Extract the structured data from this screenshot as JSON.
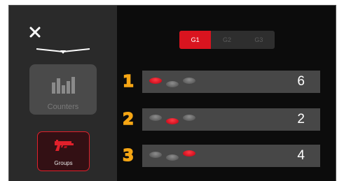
{
  "sidebar": {
    "nav": [
      {
        "label": "Counters",
        "icon": "bar-chart-icon",
        "active": false
      },
      {
        "label": "Groups",
        "icon": "pistol-icon",
        "active": true
      }
    ]
  },
  "group_tabs": [
    {
      "label": "G1",
      "active": true
    },
    {
      "label": "G2",
      "active": false
    },
    {
      "label": "G3",
      "active": false
    }
  ],
  "rows": [
    {
      "number": "1",
      "count": "6",
      "coins": [
        "red",
        "grey",
        "grey"
      ]
    },
    {
      "number": "2",
      "count": "2",
      "coins": [
        "grey",
        "red",
        "grey"
      ]
    },
    {
      "number": "3",
      "count": "4",
      "coins": [
        "grey",
        "grey",
        "red"
      ]
    }
  ],
  "colors": {
    "accent": "#d9141f",
    "row_number": "#f6a614",
    "sidebar_bg": "#2a2a2a",
    "main_bg": "#0c0c0c"
  }
}
